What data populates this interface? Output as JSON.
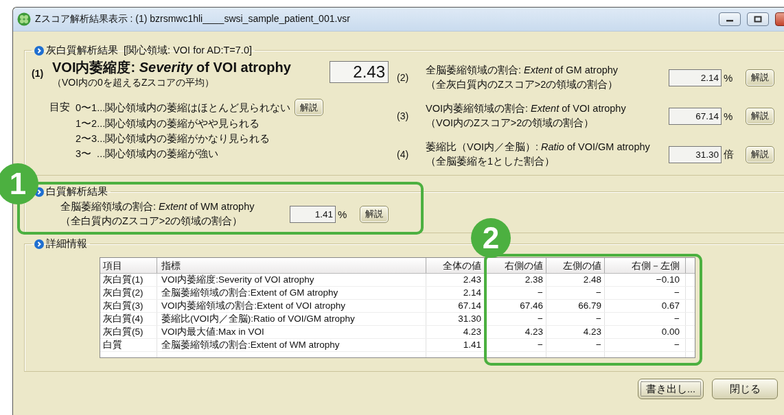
{
  "window": {
    "title": "Zスコア解析結果表示 : (1) bzrsmwc1hli____swsi_sample_patient_001.vsr"
  },
  "gray_matter": {
    "legend": "灰白質解析結果  [関心領域: VOI for AD:T=7.0]",
    "severity": {
      "number": "(1)",
      "title": "VOI内萎縮度: *Severity* of VOI atrophy",
      "subtitle": "（VOI内の0を超えるZスコアの平均）",
      "value": "2.43"
    },
    "guide": {
      "label": "目安",
      "button": "解説",
      "lines": [
        "0〜1...関心領域内の萎縮はほとんど見られない",
        "1〜2...関心領域内の萎縮がやや見られる",
        "2〜3...関心領域内の萎縮がかなり見られる",
        "3〜  ...関心領域内の萎縮が強い"
      ]
    },
    "metrics": [
      {
        "number": "(2)",
        "title": "全脳萎縮領域の割合: *Extent* of GM atrophy",
        "subtitle": "（全灰白質内のZスコア>2の領域の割合）",
        "value": "2.14",
        "unit": "%",
        "button": "解説"
      },
      {
        "number": "(3)",
        "title": "VOI内萎縮領域の割合: *Extent* of VOI atrophy",
        "subtitle": "（VOI内のZスコア>2の領域の割合）",
        "value": "67.14",
        "unit": "%",
        "button": "解説"
      },
      {
        "number": "(4)",
        "title": "萎縮比（VOI内／全脳）: *Ratio* of VOI/GM atrophy",
        "subtitle": "（全脳萎縮を1とした割合）",
        "value": "31.30",
        "unit": "倍",
        "button": "解説"
      }
    ]
  },
  "white_matter": {
    "legend": "白質解析結果",
    "title": "全脳萎縮領域の割合: *Extent* of WM atrophy",
    "subtitle": "（全白質内のZスコア>2の領域の割合）",
    "value": "1.41",
    "unit": "%",
    "button": "解説"
  },
  "details": {
    "legend": "詳細情報",
    "table": {
      "columns": [
        "項目",
        "指標",
        "全体の値",
        "右側の値",
        "左側の値",
        "右側－左側"
      ],
      "rows": [
        [
          "灰白質(1)",
          "VOI内萎縮度:Severity of VOI atrophy",
          "2.43",
          "2.38",
          "2.48",
          "−0.10"
        ],
        [
          "灰白質(2)",
          "全脳萎縮領域の割合:Extent of GM atrophy",
          "2.14",
          "−",
          "−",
          "−"
        ],
        [
          "灰白質(3)",
          "VOI内萎縮領域の割合:Extent of VOI atrophy",
          "67.14",
          "67.46",
          "66.79",
          "0.67"
        ],
        [
          "灰白質(4)",
          "萎縮比(VOI内／全脳):Ratio of VOI/GM atrophy",
          "31.30",
          "−",
          "−",
          "−"
        ],
        [
          "灰白質(5)",
          "VOI内最大値:Max in VOI",
          "4.23",
          "4.23",
          "4.23",
          "0.00"
        ],
        [
          "白質",
          "全脳萎縮領域の割合:Extent of WM atrophy",
          "1.41",
          "−",
          "−",
          "−"
        ]
      ]
    }
  },
  "buttons": [
    "書き出し...",
    "閉じる"
  ],
  "annotations": [
    {
      "label": "1"
    },
    {
      "label": "2"
    }
  ]
}
